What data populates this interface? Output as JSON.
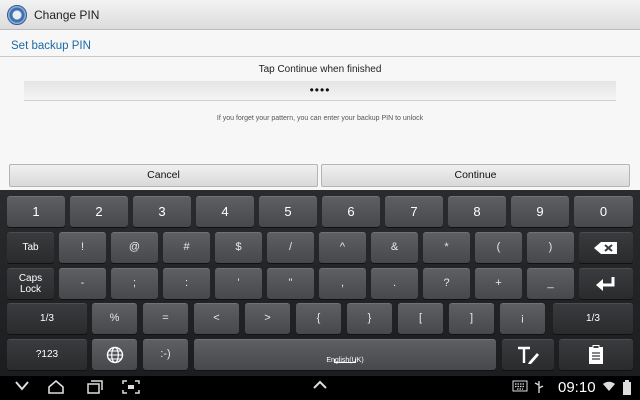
{
  "app": {
    "title": "Change PIN",
    "icon": "settings-gear-icon"
  },
  "content": {
    "section_title": "Set backup PIN",
    "instruction": "Tap Continue when finished",
    "pin_field_value": "••••",
    "hint": "If you forget your pattern, you can enter your backup PIN to unlock",
    "cancel_label": "Cancel",
    "continue_label": "Continue"
  },
  "keyboard": {
    "row1": [
      "1",
      "2",
      "3",
      "4",
      "5",
      "6",
      "7",
      "8",
      "9",
      "0"
    ],
    "row2": [
      "Tab",
      "!",
      "@",
      "#",
      "$",
      "/",
      "^",
      "&",
      "*",
      "(",
      ")"
    ],
    "row3": [
      "Caps\nLock",
      "-",
      ";",
      ":",
      "'",
      "\"",
      ",",
      ".",
      "?",
      "+",
      "_"
    ],
    "row4": [
      "1/3",
      "%",
      "=",
      "<",
      ">",
      "{",
      "}",
      "[",
      "]",
      "¡",
      "1/3"
    ],
    "row5_symbols_label": "?123",
    "row5_emoticon": ":-)",
    "space_language": "English(UK)",
    "icons": {
      "backspace": "backspace-icon",
      "enter": "enter-icon",
      "globe": "globe-icon",
      "handwriting": "handwriting-icon",
      "clipboard": "clipboard-icon"
    }
  },
  "status_bar": {
    "time": "09:10",
    "icons": [
      "back-icon",
      "home-icon",
      "recent-apps-icon",
      "screenshot-icon",
      "hide-keyboard-icon",
      "keyboard-icon",
      "usb-icon",
      "wifi-icon",
      "battery-icon"
    ]
  }
}
